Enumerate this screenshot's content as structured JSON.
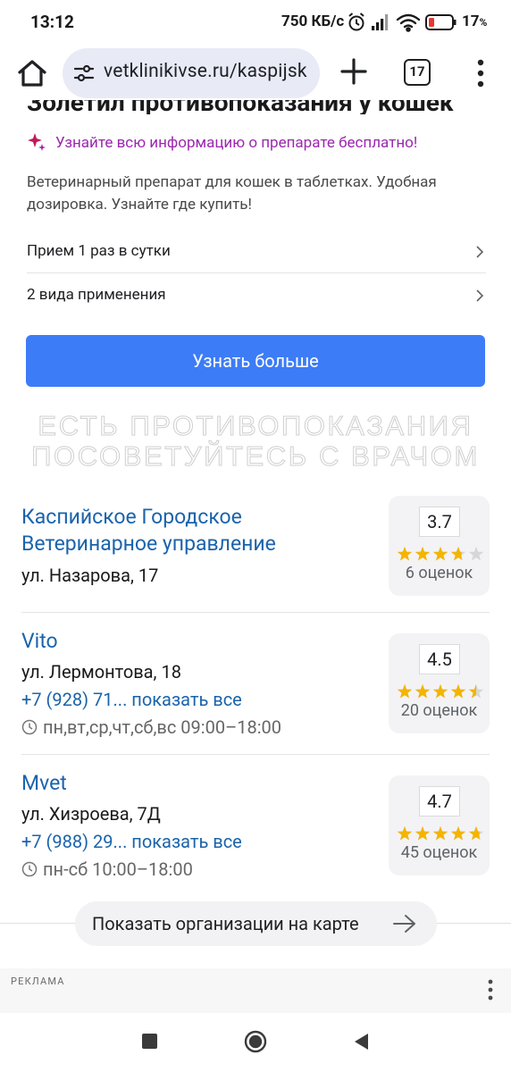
{
  "status_bar": {
    "time": "13:12",
    "network_speed": "750 КБ/с",
    "battery_percent": "17",
    "battery_suffix": "%",
    "icons": [
      "alarm-icon",
      "signal-icon",
      "wifi-icon",
      "battery-low-icon"
    ]
  },
  "browser": {
    "url": "vetklinikivse.ru/kaspijsk",
    "tab_count": "17",
    "icons": [
      "home-icon",
      "site-settings-icon",
      "new-tab-plus-icon",
      "tab-switcher-icon",
      "overflow-menu-icon"
    ]
  },
  "ad_block": {
    "cut_title": "Золетил противопоказания у кошек",
    "promo_text": "Узнайте всю информацию о препарате бесплатно!",
    "description": "Ветеринарный препарат для кошек в таблетках. Удобная дозировка. Узнайте где купить!",
    "features": [
      {
        "label": "Прием 1 раз в сутки"
      },
      {
        "label": "2 вида применения"
      }
    ],
    "cta_label": "Узнать больше",
    "warning_line1": "ЕСТЬ ПРОТИВОПОКАЗАНИЯ",
    "warning_line2": "ПОСОВЕТУЙТЕСЬ С ВРАЧОМ"
  },
  "organizations": [
    {
      "name_line1": "Каспийское Городское",
      "name_line2": "Ветеринарное управление",
      "address": "ул. Назарова, 17",
      "rating": "3.7",
      "stars": 3.7,
      "reviews": "6 оценок"
    },
    {
      "name": "Vito",
      "address": "ул. Лермонтова, 18",
      "phone": "+7 (928) 71... показать все",
      "hours": "пн,вт,ср,чт,сб,вс 09:00–18:00",
      "rating": "4.5",
      "stars": 4.5,
      "reviews": "20 оценок"
    },
    {
      "name": "Mvet",
      "address": "ул. Хизроева, 7Д",
      "phone": "+7 (988) 29... показать все",
      "hours": "пн-сб 10:00–18:00",
      "rating": "4.7",
      "stars": 4.7,
      "reviews": "45 оценок"
    }
  ],
  "map_button_label": "Показать организации на карте",
  "footer_ad_label": "РЕКЛАМА",
  "colors": {
    "link_blue": "#1a63ab",
    "cta_blue": "#3d7cf7",
    "promo_purple": "#9c27b0",
    "star_gold": "#f4b400",
    "star_empty": "#d6d6d6"
  }
}
